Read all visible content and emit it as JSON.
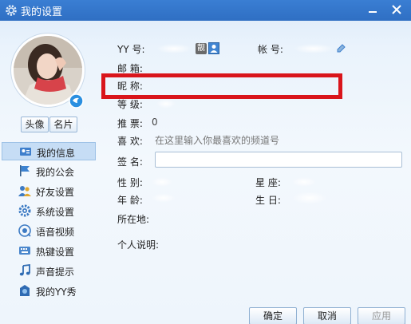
{
  "window": {
    "title": "我的设置"
  },
  "profile": {
    "photo_button": "头像",
    "card_button": "名片"
  },
  "sidebar": {
    "items": [
      {
        "label": "我的信息",
        "icon": "profile-card-icon",
        "selected": true
      },
      {
        "label": "我的公会",
        "icon": "flag-icon",
        "selected": false
      },
      {
        "label": "好友设置",
        "icon": "friends-icon",
        "selected": false
      },
      {
        "label": "系统设置",
        "icon": "gear-icon",
        "selected": false
      },
      {
        "label": "语音视频",
        "icon": "headset-icon",
        "selected": false
      },
      {
        "label": "热键设置",
        "icon": "keyboard-icon",
        "selected": false
      },
      {
        "label": "声音提示",
        "icon": "music-note-icon",
        "selected": false
      },
      {
        "label": "我的YY秀",
        "icon": "yy-show-icon",
        "selected": false
      }
    ]
  },
  "form": {
    "yy_label": "YY  号:",
    "account_label": "帐  号:",
    "email_label": "邮  箱:",
    "nickname_label": "昵  称:",
    "level_label": "等  级:",
    "votes_label": "推  票:",
    "votes_value": "0",
    "hobby_label": "喜  欢:",
    "hobby_placeholder": "在这里输入你最喜欢的频道号",
    "sign_label": "签  名:",
    "gender_label": "性  别:",
    "zodiac_label": "星  座:",
    "age_label": "年  龄:",
    "birthday_label": "生  日:",
    "location_label": "所在地:",
    "bio_label": "个人说明:",
    "badge_text": "靓"
  },
  "footer": {
    "ok": "确定",
    "cancel": "取消",
    "apply": "应用"
  },
  "colors": {
    "titlebar": "#2f6fc3",
    "highlight": "#d9151b",
    "selected_row": "#c6ddf5"
  }
}
